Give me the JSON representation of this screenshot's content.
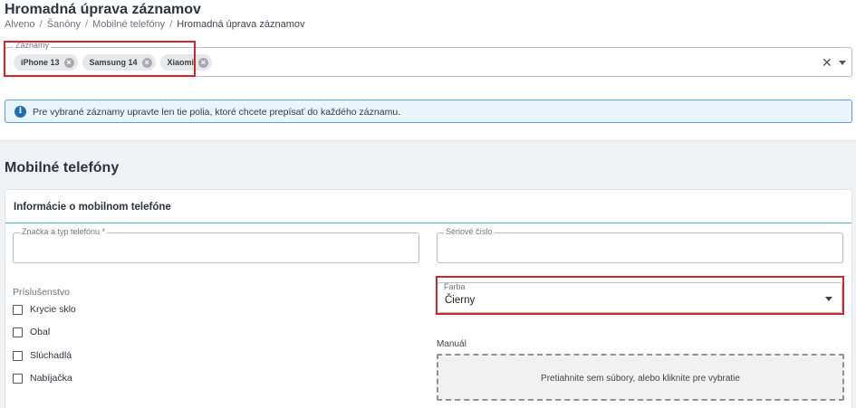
{
  "page": {
    "title": "Hromadná úprava záznamov",
    "breadcrumb": [
      "Alveno",
      "Šanóny",
      "Mobilné telefóny",
      "Hromadná úprava záznamov"
    ]
  },
  "records": {
    "label": "Záznamy",
    "chips": [
      "iPhone 13",
      "Samsung 14",
      "Xiaomi"
    ],
    "clear_icon": "close-icon",
    "dropdown_icon": "caret-down-icon"
  },
  "info": {
    "icon": "info-icon",
    "text": "Pre vybrané záznamy upravte len tie polia, ktoré chcete prepísať do každého záznamu."
  },
  "section": {
    "title": "Mobilné telefóny"
  },
  "card": {
    "title": "Informácie o mobilnom telefóne",
    "brand_field": {
      "label": "Značka a typ telefónu *",
      "value": ""
    },
    "serial_field": {
      "label": "Sériové číslo",
      "value": ""
    },
    "accessories": {
      "label": "Príslušenstvo",
      "items": [
        {
          "label": "Krycie sklo",
          "checked": false
        },
        {
          "label": "Obal",
          "checked": false
        },
        {
          "label": "Slúchadlá",
          "checked": false
        },
        {
          "label": "Nabíjačka",
          "checked": false
        }
      ]
    },
    "color_field": {
      "label": "Farba",
      "value": "Čierny"
    },
    "manual": {
      "label": "Manuál",
      "dropzone_text": "Pretiahnite sem súbory, alebo kliknite pre vybratie"
    }
  },
  "colors": {
    "highlight": "#d5242c",
    "info_border": "#5aa0d6",
    "info_icon": "#1d6fb5",
    "card_header_rule": "#3fbcae"
  }
}
